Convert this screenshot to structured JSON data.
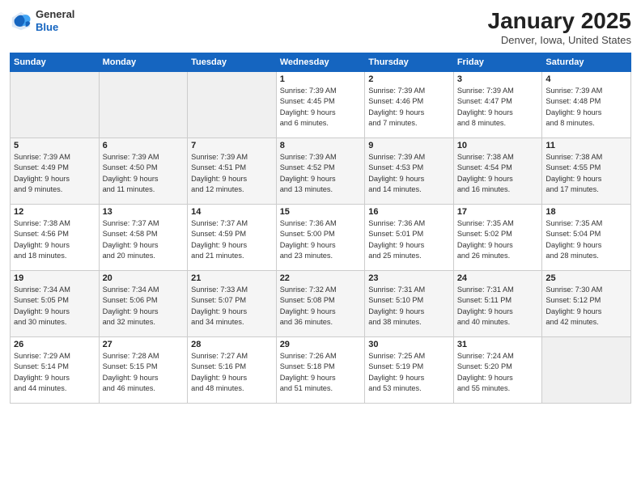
{
  "header": {
    "logo_line1": "General",
    "logo_line2": "Blue",
    "month": "January 2025",
    "location": "Denver, Iowa, United States"
  },
  "days_of_week": [
    "Sunday",
    "Monday",
    "Tuesday",
    "Wednesday",
    "Thursday",
    "Friday",
    "Saturday"
  ],
  "weeks": [
    [
      {
        "day": "",
        "info": ""
      },
      {
        "day": "",
        "info": ""
      },
      {
        "day": "",
        "info": ""
      },
      {
        "day": "1",
        "info": "Sunrise: 7:39 AM\nSunset: 4:45 PM\nDaylight: 9 hours\nand 6 minutes."
      },
      {
        "day": "2",
        "info": "Sunrise: 7:39 AM\nSunset: 4:46 PM\nDaylight: 9 hours\nand 7 minutes."
      },
      {
        "day": "3",
        "info": "Sunrise: 7:39 AM\nSunset: 4:47 PM\nDaylight: 9 hours\nand 8 minutes."
      },
      {
        "day": "4",
        "info": "Sunrise: 7:39 AM\nSunset: 4:48 PM\nDaylight: 9 hours\nand 8 minutes."
      }
    ],
    [
      {
        "day": "5",
        "info": "Sunrise: 7:39 AM\nSunset: 4:49 PM\nDaylight: 9 hours\nand 9 minutes."
      },
      {
        "day": "6",
        "info": "Sunrise: 7:39 AM\nSunset: 4:50 PM\nDaylight: 9 hours\nand 11 minutes."
      },
      {
        "day": "7",
        "info": "Sunrise: 7:39 AM\nSunset: 4:51 PM\nDaylight: 9 hours\nand 12 minutes."
      },
      {
        "day": "8",
        "info": "Sunrise: 7:39 AM\nSunset: 4:52 PM\nDaylight: 9 hours\nand 13 minutes."
      },
      {
        "day": "9",
        "info": "Sunrise: 7:39 AM\nSunset: 4:53 PM\nDaylight: 9 hours\nand 14 minutes."
      },
      {
        "day": "10",
        "info": "Sunrise: 7:38 AM\nSunset: 4:54 PM\nDaylight: 9 hours\nand 16 minutes."
      },
      {
        "day": "11",
        "info": "Sunrise: 7:38 AM\nSunset: 4:55 PM\nDaylight: 9 hours\nand 17 minutes."
      }
    ],
    [
      {
        "day": "12",
        "info": "Sunrise: 7:38 AM\nSunset: 4:56 PM\nDaylight: 9 hours\nand 18 minutes."
      },
      {
        "day": "13",
        "info": "Sunrise: 7:37 AM\nSunset: 4:58 PM\nDaylight: 9 hours\nand 20 minutes."
      },
      {
        "day": "14",
        "info": "Sunrise: 7:37 AM\nSunset: 4:59 PM\nDaylight: 9 hours\nand 21 minutes."
      },
      {
        "day": "15",
        "info": "Sunrise: 7:36 AM\nSunset: 5:00 PM\nDaylight: 9 hours\nand 23 minutes."
      },
      {
        "day": "16",
        "info": "Sunrise: 7:36 AM\nSunset: 5:01 PM\nDaylight: 9 hours\nand 25 minutes."
      },
      {
        "day": "17",
        "info": "Sunrise: 7:35 AM\nSunset: 5:02 PM\nDaylight: 9 hours\nand 26 minutes."
      },
      {
        "day": "18",
        "info": "Sunrise: 7:35 AM\nSunset: 5:04 PM\nDaylight: 9 hours\nand 28 minutes."
      }
    ],
    [
      {
        "day": "19",
        "info": "Sunrise: 7:34 AM\nSunset: 5:05 PM\nDaylight: 9 hours\nand 30 minutes."
      },
      {
        "day": "20",
        "info": "Sunrise: 7:34 AM\nSunset: 5:06 PM\nDaylight: 9 hours\nand 32 minutes."
      },
      {
        "day": "21",
        "info": "Sunrise: 7:33 AM\nSunset: 5:07 PM\nDaylight: 9 hours\nand 34 minutes."
      },
      {
        "day": "22",
        "info": "Sunrise: 7:32 AM\nSunset: 5:08 PM\nDaylight: 9 hours\nand 36 minutes."
      },
      {
        "day": "23",
        "info": "Sunrise: 7:31 AM\nSunset: 5:10 PM\nDaylight: 9 hours\nand 38 minutes."
      },
      {
        "day": "24",
        "info": "Sunrise: 7:31 AM\nSunset: 5:11 PM\nDaylight: 9 hours\nand 40 minutes."
      },
      {
        "day": "25",
        "info": "Sunrise: 7:30 AM\nSunset: 5:12 PM\nDaylight: 9 hours\nand 42 minutes."
      }
    ],
    [
      {
        "day": "26",
        "info": "Sunrise: 7:29 AM\nSunset: 5:14 PM\nDaylight: 9 hours\nand 44 minutes."
      },
      {
        "day": "27",
        "info": "Sunrise: 7:28 AM\nSunset: 5:15 PM\nDaylight: 9 hours\nand 46 minutes."
      },
      {
        "day": "28",
        "info": "Sunrise: 7:27 AM\nSunset: 5:16 PM\nDaylight: 9 hours\nand 48 minutes."
      },
      {
        "day": "29",
        "info": "Sunrise: 7:26 AM\nSunset: 5:18 PM\nDaylight: 9 hours\nand 51 minutes."
      },
      {
        "day": "30",
        "info": "Sunrise: 7:25 AM\nSunset: 5:19 PM\nDaylight: 9 hours\nand 53 minutes."
      },
      {
        "day": "31",
        "info": "Sunrise: 7:24 AM\nSunset: 5:20 PM\nDaylight: 9 hours\nand 55 minutes."
      },
      {
        "day": "",
        "info": ""
      }
    ]
  ]
}
